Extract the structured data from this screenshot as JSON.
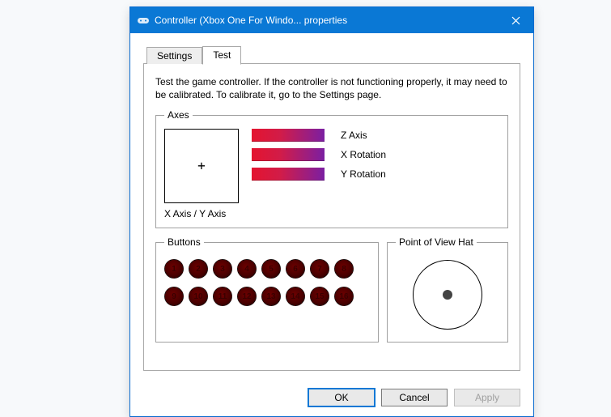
{
  "window": {
    "title": "Controller (Xbox One For Windo... properties"
  },
  "tabs": {
    "settings": "Settings",
    "test": "Test",
    "active": "Test"
  },
  "description": "Test the game controller.  If the controller is not functioning properly, it may need to be calibrated.  To calibrate it, go to the Settings page.",
  "axes": {
    "legend": "Axes",
    "xy_caption": "X Axis / Y Axis",
    "rows": [
      {
        "label": "Z Axis"
      },
      {
        "label": "X Rotation"
      },
      {
        "label": "Y Rotation"
      }
    ]
  },
  "buttons_group": {
    "legend": "Buttons",
    "row1": [
      "1",
      "2",
      "3",
      "4",
      "5",
      "6",
      "7",
      "8"
    ],
    "row2": [
      "9",
      "10",
      "11",
      "12",
      "13",
      "14",
      "15",
      "16"
    ]
  },
  "pov": {
    "legend": "Point of View Hat"
  },
  "dialog": {
    "ok": "OK",
    "cancel": "Cancel",
    "apply": "Apply"
  }
}
